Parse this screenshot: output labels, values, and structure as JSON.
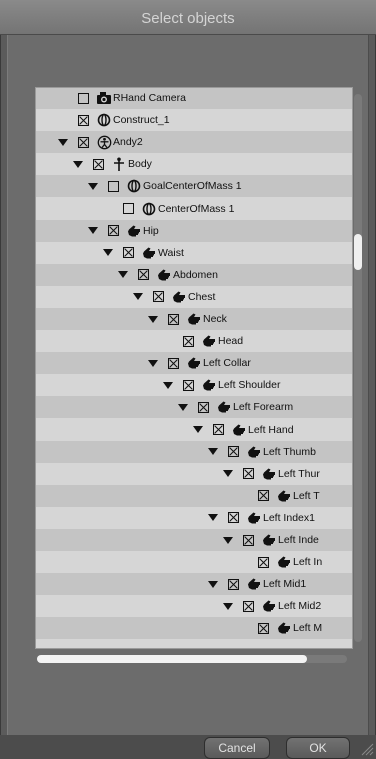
{
  "dialog": {
    "title": "Select objects"
  },
  "buttons": {
    "cancel": "Cancel",
    "ok": "OK"
  },
  "rows": [
    {
      "label": "RHand Camera",
      "depth": 0,
      "expander": false,
      "checked": false,
      "icon": "camera-icon"
    },
    {
      "label": "Construct_1",
      "depth": 0,
      "expander": false,
      "checked": true,
      "icon": "construct-icon"
    },
    {
      "label": "Andy2",
      "depth": 0,
      "expander": true,
      "checked": true,
      "icon": "figure-icon"
    },
    {
      "label": "Body",
      "depth": 1,
      "expander": true,
      "checked": true,
      "icon": "body-icon"
    },
    {
      "label": "GoalCenterOfMass 1",
      "depth": 2,
      "expander": true,
      "checked": false,
      "icon": "construct-icon"
    },
    {
      "label": "CenterOfMass 1",
      "depth": 3,
      "expander": false,
      "checked": false,
      "icon": "construct-icon"
    },
    {
      "label": "Hip",
      "depth": 2,
      "expander": true,
      "checked": true,
      "icon": "hand-icon"
    },
    {
      "label": "Waist",
      "depth": 3,
      "expander": true,
      "checked": true,
      "icon": "hand-icon"
    },
    {
      "label": "Abdomen",
      "depth": 4,
      "expander": true,
      "checked": true,
      "icon": "hand-icon"
    },
    {
      "label": "Chest",
      "depth": 5,
      "expander": true,
      "checked": true,
      "icon": "hand-icon"
    },
    {
      "label": "Neck",
      "depth": 6,
      "expander": true,
      "checked": true,
      "icon": "hand-icon"
    },
    {
      "label": "Head",
      "depth": 7,
      "expander": false,
      "checked": true,
      "icon": "hand-icon"
    },
    {
      "label": "Left Collar",
      "depth": 6,
      "expander": true,
      "checked": true,
      "icon": "hand-icon"
    },
    {
      "label": "Left Shoulder",
      "depth": 7,
      "expander": true,
      "checked": true,
      "icon": "hand-icon"
    },
    {
      "label": "Left Forearm",
      "depth": 8,
      "expander": true,
      "checked": true,
      "icon": "hand-icon"
    },
    {
      "label": "Left Hand",
      "depth": 9,
      "expander": true,
      "checked": true,
      "icon": "hand-icon"
    },
    {
      "label": "Left Thumb",
      "depth": 10,
      "expander": true,
      "checked": true,
      "icon": "hand-icon"
    },
    {
      "label": "Left Thur",
      "depth": 11,
      "expander": true,
      "checked": true,
      "icon": "hand-icon"
    },
    {
      "label": "Left T",
      "depth": 12,
      "expander": false,
      "checked": true,
      "icon": "hand-icon"
    },
    {
      "label": "Left Index1",
      "depth": 10,
      "expander": true,
      "checked": true,
      "icon": "hand-icon"
    },
    {
      "label": "Left Inde",
      "depth": 11,
      "expander": true,
      "checked": true,
      "icon": "hand-icon"
    },
    {
      "label": "Left In",
      "depth": 12,
      "expander": false,
      "checked": true,
      "icon": "hand-icon"
    },
    {
      "label": "Left Mid1",
      "depth": 10,
      "expander": true,
      "checked": true,
      "icon": "hand-icon"
    },
    {
      "label": "Left Mid2",
      "depth": 11,
      "expander": true,
      "checked": true,
      "icon": "hand-icon"
    },
    {
      "label": "Left M",
      "depth": 12,
      "expander": false,
      "checked": true,
      "icon": "hand-icon"
    }
  ]
}
